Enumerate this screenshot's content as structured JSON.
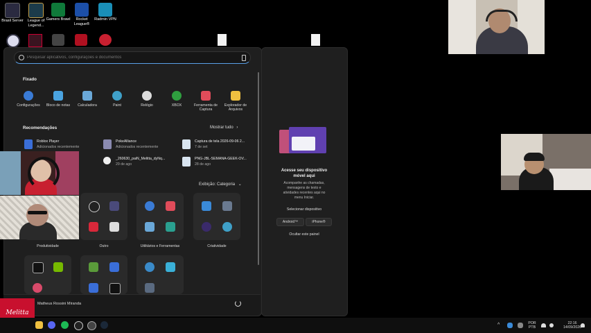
{
  "desktop": {
    "icons": [
      {
        "label": "Brasil Server",
        "color": "#2a2a40"
      },
      {
        "label": "League of Legend...",
        "color": "#1c3b4a"
      },
      {
        "label": "Gamers Brawl",
        "color": "#0f7a3a"
      },
      {
        "label": "Rocket League®",
        "color": "#1c4fa8"
      },
      {
        "label": "Radmin VPN",
        "color": "#1a8fb8"
      }
    ]
  },
  "start_menu": {
    "search": {
      "placeholder": "Pesquisar aplicativos, configurações e documentos"
    },
    "pinned_title": "Fixado",
    "pinned": [
      {
        "label": "Configurações",
        "icon": "gear-icon",
        "color": "#3a7bd5"
      },
      {
        "label": "Bloco de notas",
        "icon": "notepad-icon",
        "color": "#4aa3e0"
      },
      {
        "label": "Calculadora",
        "icon": "calculator-icon",
        "color": "#6aa8d8"
      },
      {
        "label": "Paint",
        "icon": "paint-icon",
        "color": "#3fa0c8"
      },
      {
        "label": "Relógio",
        "icon": "clock-icon",
        "color": "#dcdcdc"
      },
      {
        "label": "XBOX",
        "icon": "xbox-icon",
        "color": "#2f9e3f"
      },
      {
        "label": "Ferramenta de Captura",
        "icon": "snipping-icon",
        "color": "#e04c5a"
      },
      {
        "label": "Explorador de Arquivos",
        "icon": "folder-icon",
        "color": "#f0c040"
      }
    ],
    "recommended_title": "Recomendações",
    "show_all": "Mostrar tudo",
    "recommended": [
      {
        "title": "Roblox Player",
        "sub": "Adicionados recentemente",
        "color": "#3a6ed8"
      },
      {
        "title": "PokeAlliance",
        "sub": "Adicionados recentemente",
        "color": "#8a8ab0"
      },
      {
        "title": "Captura de tela 2026-09-06 2...",
        "sub": "7 de set",
        "color": "#d8e4f0"
      },
      {
        "title": "_260630_paiN_Melitta_dyNq...",
        "sub": "29 de ago",
        "color": "#eeeeee"
      },
      {
        "title": "PNG-JBL-SEMANA-GEEK-OV...",
        "sub": "28 de ago",
        "color": "#d8e4f0"
      }
    ],
    "view_label": "Exibição: Categoria",
    "categories": [
      {
        "label": "Produtividade"
      },
      {
        "label": "Outro"
      },
      {
        "label": "Utilitários e Ferramentas"
      },
      {
        "label": "Criatividade"
      }
    ],
    "user_name": "Matheus Rossini Miranda"
  },
  "phone_panel": {
    "title": "Acesse seu dispositivo móvel aqui",
    "description": "Acompanhe as chamadas, mensagens de texto e atividades recentes aqui no menu Iniciar.",
    "select_label": "Selecionar dispositivo",
    "android_label": "Android™",
    "iphone_label": "iPhone®",
    "hide_label": "Ocultar este painel"
  },
  "taskbar": {
    "lang_line1": "POR",
    "lang_line2": "PTB",
    "time": "22:16",
    "date": "14/09/2026"
  },
  "overlay": {
    "logo_text": "Melitta"
  },
  "colors": {
    "accent": "#5aa0e8",
    "menu_bg": "#1f1f1f",
    "tile_bg": "#2a2a2a",
    "logo_red": "#c8102e"
  }
}
